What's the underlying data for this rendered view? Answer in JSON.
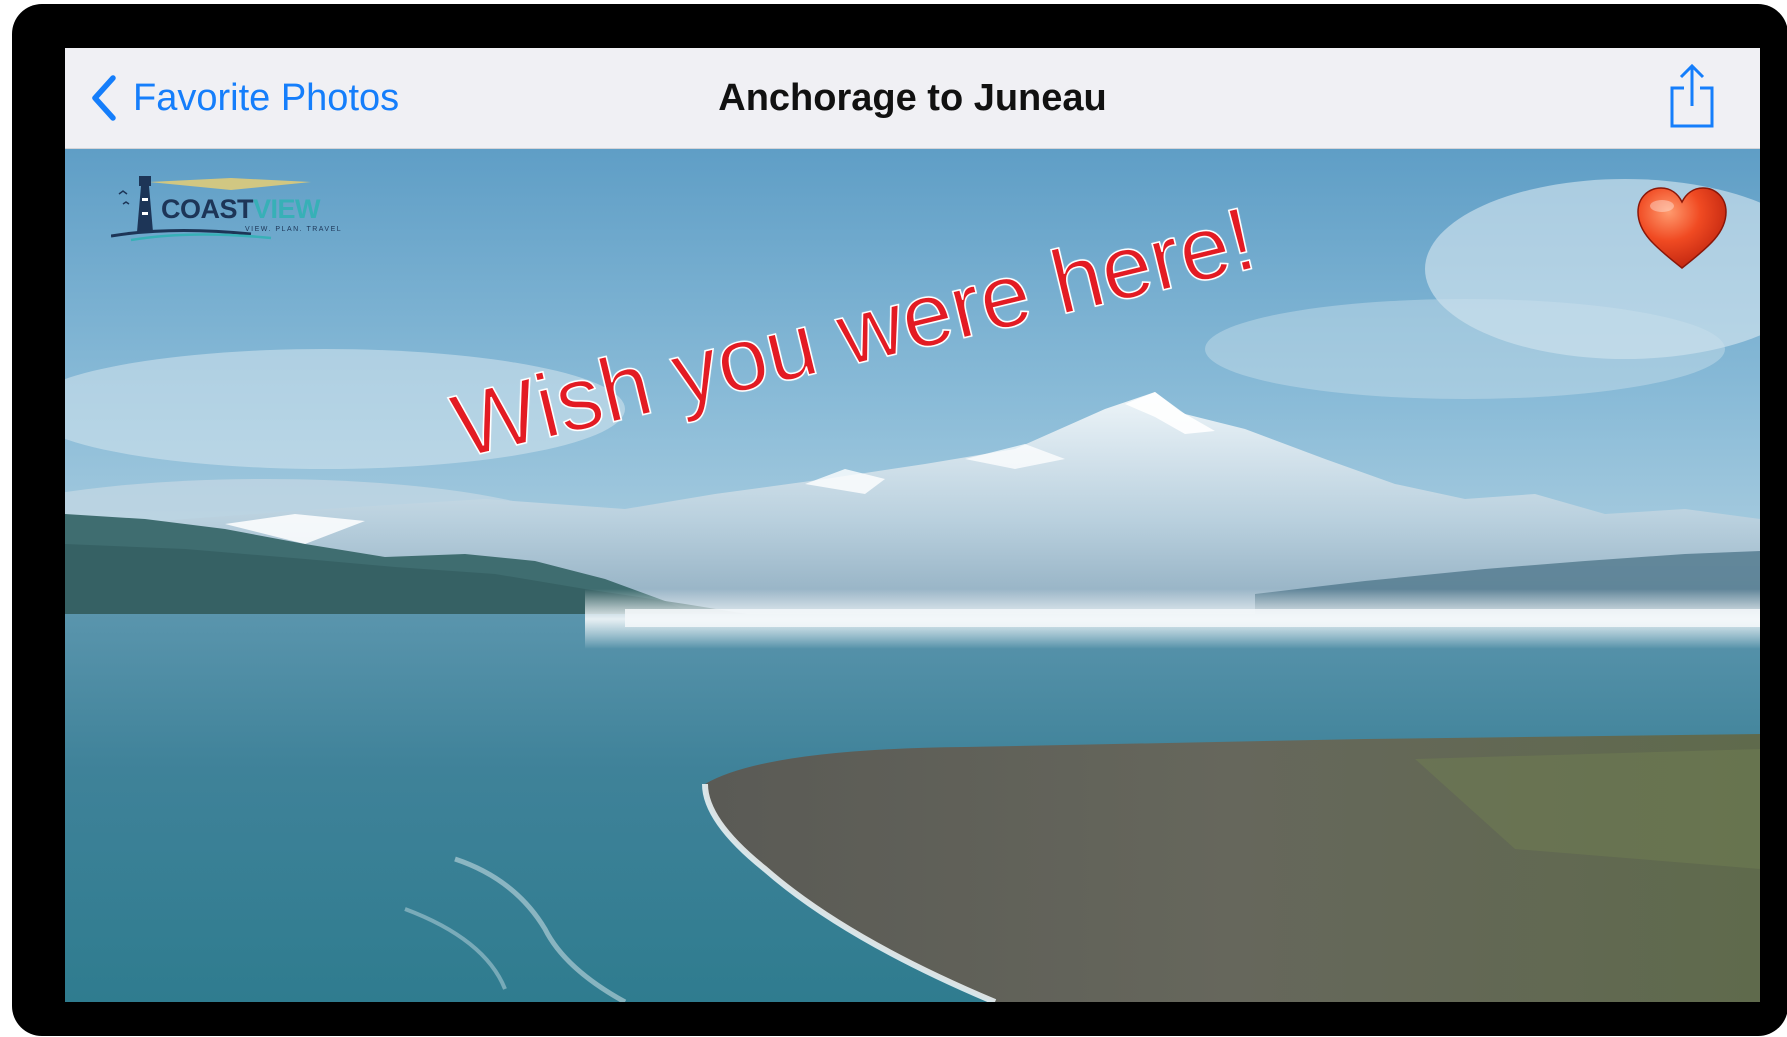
{
  "navbar": {
    "back_label": "Favorite Photos",
    "title": "Anchorage to Juneau",
    "back_icon": "chevron-left-icon",
    "share_icon": "share-icon",
    "accent_color": "#157efb"
  },
  "photo": {
    "logo": {
      "brand_primary": "COAST",
      "brand_secondary": "VIEW",
      "tagline": "VIEW. PLAN. TRAVEL",
      "icon": "lighthouse-icon"
    },
    "favorite_icon": "heart-icon",
    "caption": "Wish you were here!",
    "caption_color": "#e31b23"
  }
}
